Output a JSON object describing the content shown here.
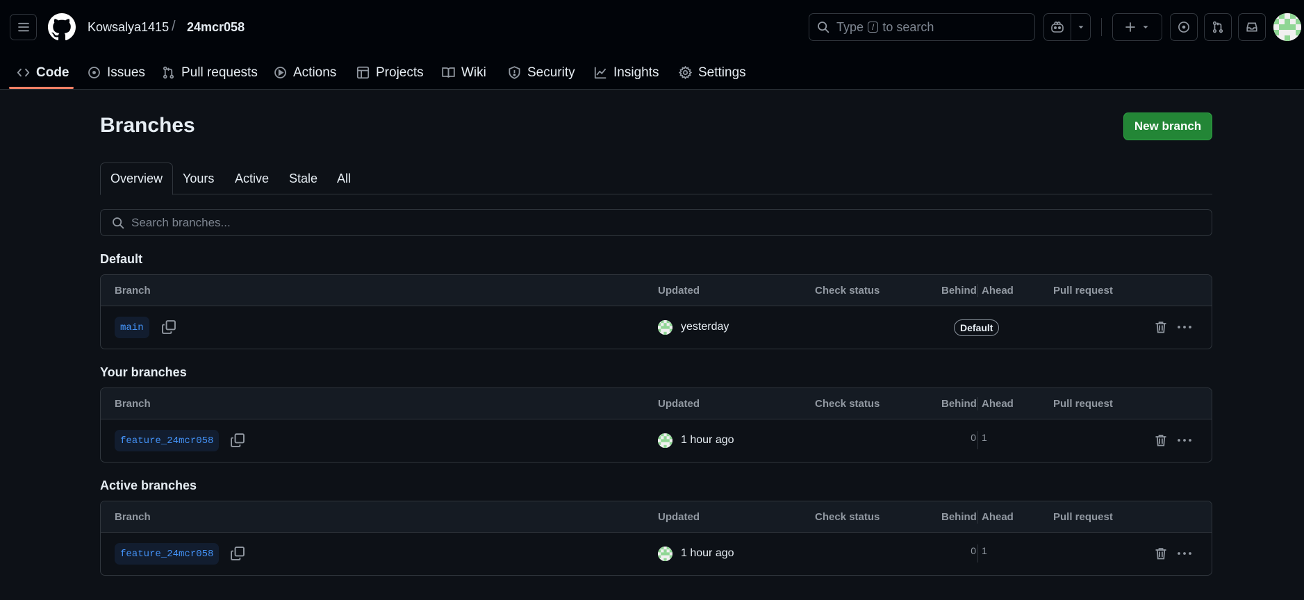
{
  "header": {
    "owner": "Kowsalya1415",
    "separator": "/",
    "repo": "24mcr058",
    "search": {
      "prefix": "Type",
      "key": "/",
      "suffix": "to search"
    }
  },
  "repo_nav": {
    "tabs": [
      {
        "label": "Code",
        "icon": "code-icon"
      },
      {
        "label": "Issues",
        "icon": "issue-icon"
      },
      {
        "label": "Pull requests",
        "icon": "pull-request-icon"
      },
      {
        "label": "Actions",
        "icon": "play-icon"
      },
      {
        "label": "Projects",
        "icon": "table-icon"
      },
      {
        "label": "Wiki",
        "icon": "book-icon"
      },
      {
        "label": "Security",
        "icon": "shield-icon"
      },
      {
        "label": "Insights",
        "icon": "graph-icon"
      },
      {
        "label": "Settings",
        "icon": "gear-icon"
      }
    ],
    "selected": "Code"
  },
  "page": {
    "title": "Branches",
    "new_branch_label": "New branch",
    "subtabs": [
      "Overview",
      "Yours",
      "Active",
      "Stale",
      "All"
    ],
    "selected_subtab": "Overview",
    "search_placeholder": "Search branches..."
  },
  "columns": {
    "branch": "Branch",
    "updated": "Updated",
    "check_status": "Check status",
    "behind": "Behind",
    "ahead": "Ahead",
    "pull_request": "Pull request"
  },
  "sections": [
    {
      "title": "Default",
      "rows": [
        {
          "branch": "main",
          "updated": "yesterday",
          "default_badge": "Default",
          "behind": "",
          "ahead": ""
        }
      ]
    },
    {
      "title": "Your branches",
      "rows": [
        {
          "branch": "feature_24mcr058",
          "updated": "1 hour ago",
          "default_badge": "",
          "behind": "0",
          "ahead": "1"
        }
      ]
    },
    {
      "title": "Active branches",
      "rows": [
        {
          "branch": "feature_24mcr058",
          "updated": "1 hour ago",
          "default_badge": "",
          "behind": "0",
          "ahead": "1"
        }
      ]
    }
  ],
  "colors": {
    "background": "#0d1117",
    "header_bg": "#010409",
    "border": "#30363d",
    "accent_green": "#238636",
    "link_blue": "#4493f8",
    "tab_underline": "#f78166"
  }
}
